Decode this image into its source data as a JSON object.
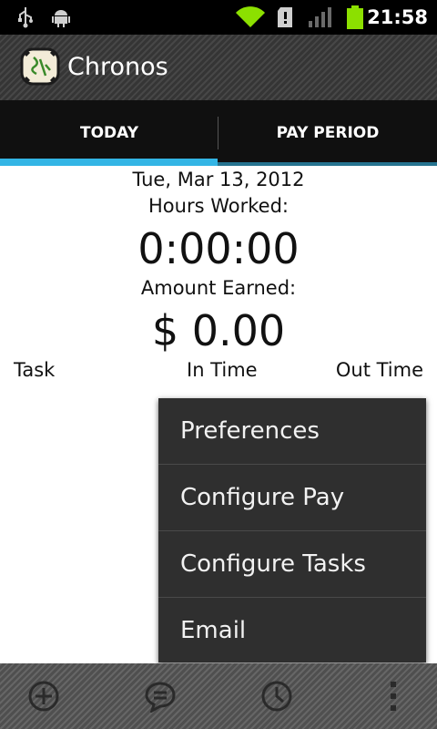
{
  "status_bar": {
    "time": "21:58",
    "icons": [
      "usb-icon",
      "android-debug-icon",
      "wifi-icon",
      "sd-card-icon",
      "signal-icon",
      "battery-icon"
    ]
  },
  "action_bar": {
    "title": "Chronos",
    "icon": "chronos-logo-icon"
  },
  "tabs": [
    {
      "label": "TODAY",
      "selected": true
    },
    {
      "label": "PAY PERIOD",
      "selected": false
    }
  ],
  "today": {
    "date": "Tue, Mar 13, 2012",
    "hours_label": "Hours Worked:",
    "hours_value": "0:00:00",
    "amount_label": "Amount Earned:",
    "amount_value": "$ 0.00",
    "columns": [
      "Task",
      "In Time",
      "Out Time"
    ]
  },
  "menu": {
    "items": [
      {
        "label": "Preferences"
      },
      {
        "label": "Configure Pay"
      },
      {
        "label": "Configure Tasks"
      },
      {
        "label": "Email"
      }
    ]
  },
  "bottom_bar": {
    "buttons": [
      "add-icon",
      "note-icon",
      "clock-icon",
      "overflow-menu-icon"
    ]
  },
  "colors": {
    "accent": "#33b5e5",
    "menu_bg": "#2f2f2f",
    "tab_bg": "#101010"
  }
}
